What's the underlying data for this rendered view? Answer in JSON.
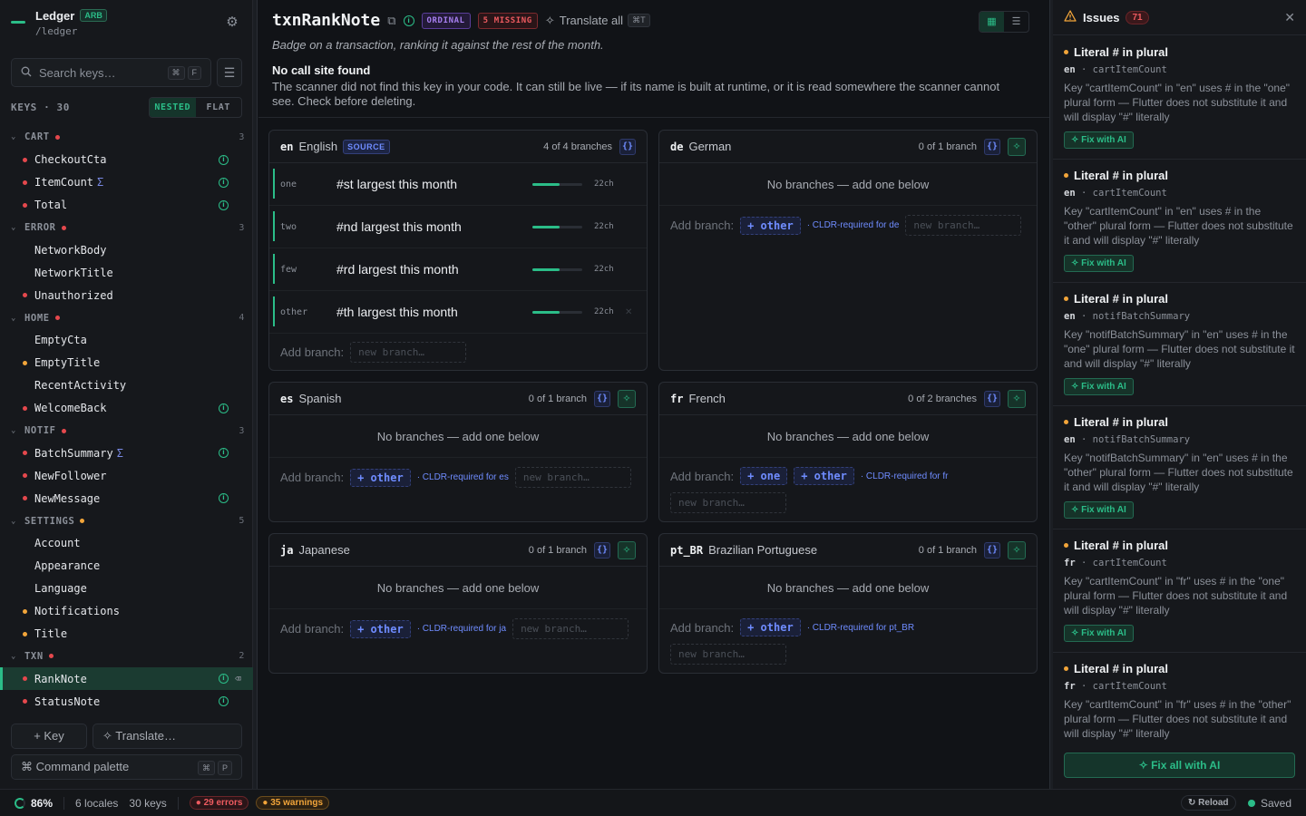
{
  "app": {
    "name": "Ledger",
    "format_badge": "ARB",
    "path": "/ledger"
  },
  "search": {
    "placeholder": "Search keys…",
    "kbd1": "⌘",
    "kbd2": "F"
  },
  "keys_header": "KEYS · 30",
  "view_mode": {
    "nested": "NESTED",
    "flat": "FLAT"
  },
  "tree": {
    "groups": [
      {
        "name": "CART",
        "count": "3",
        "dot": "red",
        "items": [
          {
            "label": "CheckoutCta",
            "bullet": "red",
            "info": true
          },
          {
            "label": "ItemCount",
            "bullet": "red",
            "info": true,
            "plural": true
          },
          {
            "label": "Total",
            "bullet": "red",
            "info": true
          }
        ]
      },
      {
        "name": "ERROR",
        "count": "3",
        "dot": "red",
        "items": [
          {
            "label": "NetworkBody"
          },
          {
            "label": "NetworkTitle"
          },
          {
            "label": "Unauthorized",
            "bullet": "red"
          }
        ]
      },
      {
        "name": "HOME",
        "count": "4",
        "dot": "red",
        "items": [
          {
            "label": "EmptyCta"
          },
          {
            "label": "EmptyTitle",
            "bullet": "orange"
          },
          {
            "label": "RecentActivity"
          },
          {
            "label": "WelcomeBack",
            "bullet": "red",
            "info": true
          }
        ]
      },
      {
        "name": "NOTIF",
        "count": "3",
        "dot": "red",
        "items": [
          {
            "label": "BatchSummary",
            "bullet": "red",
            "info": true,
            "plural": true
          },
          {
            "label": "NewFollower",
            "bullet": "red"
          },
          {
            "label": "NewMessage",
            "bullet": "red",
            "info": true
          }
        ]
      },
      {
        "name": "SETTINGS",
        "count": "5",
        "dot": "orange",
        "items": [
          {
            "label": "Account"
          },
          {
            "label": "Appearance"
          },
          {
            "label": "Language"
          },
          {
            "label": "Notifications",
            "bullet": "orange"
          },
          {
            "label": "Title",
            "bullet": "orange"
          }
        ]
      },
      {
        "name": "TXN",
        "count": "2",
        "dot": "red",
        "items": [
          {
            "label": "RankNote",
            "bullet": "red",
            "info": true,
            "selected": true
          },
          {
            "label": "StatusNote",
            "bullet": "red",
            "info": true
          }
        ]
      }
    ]
  },
  "sidebar_actions": {
    "add_key": "+ Key",
    "translate": "Translate…",
    "command_palette": "Command palette",
    "cmd_kbd1": "⌘",
    "cmd_kbd2": "P"
  },
  "key": {
    "title": "txnRankNote",
    "badge_type": "ORDINAL",
    "badge_missing": "5 MISSING",
    "translate_all": "Translate all",
    "translate_kbd": "⌘T",
    "description": "Badge on a transaction, ranking it against the rest of the month.",
    "warning_title": "No call site found",
    "warning_body": "The scanner did not find this key in your code. It can still be live — if its name is built at runtime, or it is read somewhere the scanner cannot see. Check before deleting."
  },
  "locales": {
    "en": {
      "code": "en",
      "name": "English",
      "source_badge": "SOURCE",
      "count": "4 of 4 branches",
      "branches": [
        {
          "form": "one",
          "text": "#st largest this month",
          "len": "22ch",
          "fill": 0.55
        },
        {
          "form": "two",
          "text": "#nd largest this month",
          "len": "22ch",
          "fill": 0.55
        },
        {
          "form": "few",
          "text": "#rd largest this month",
          "len": "22ch",
          "fill": 0.55
        },
        {
          "form": "other",
          "text": "#th largest this month",
          "len": "22ch",
          "fill": 0.55
        }
      ],
      "add_label": "Add branch:",
      "new_branch": "new branch…"
    },
    "de": {
      "code": "de",
      "name": "German",
      "count": "0 of 1 branch",
      "empty": "No branches — add one below",
      "add_label": "Add branch:",
      "chips": [
        "+ other"
      ],
      "cldr": "· CLDR-required for de",
      "new_branch": "new branch…"
    },
    "es": {
      "code": "es",
      "name": "Spanish",
      "count": "0 of 1 branch",
      "empty": "No branches — add one below",
      "add_label": "Add branch:",
      "chips": [
        "+ other"
      ],
      "cldr": "· CLDR-required for es",
      "new_branch": "new branch…"
    },
    "fr": {
      "code": "fr",
      "name": "French",
      "count": "0 of 2 branches",
      "empty": "No branches — add one below",
      "add_label": "Add branch:",
      "chips": [
        "+ one",
        "+ other"
      ],
      "cldr": "· CLDR-required for fr",
      "new_branch": "new branch…"
    },
    "ja": {
      "code": "ja",
      "name": "Japanese",
      "count": "0 of 1 branch",
      "empty": "No branches — add one below",
      "add_label": "Add branch:",
      "chips": [
        "+ other"
      ],
      "cldr": "· CLDR-required for ja",
      "new_branch": "new branch…"
    },
    "pt_BR": {
      "code": "pt_BR",
      "name": "Brazilian Portuguese",
      "count": "0 of 1 branch",
      "empty": "No branches — add one below",
      "add_label": "Add branch:",
      "chips": [
        "+ other"
      ],
      "cldr": "· CLDR-required for pt_BR",
      "new_branch": "new branch…"
    }
  },
  "issues_panel": {
    "title": "Issues",
    "count": "71",
    "fix_all": "Fix all with AI",
    "items": [
      {
        "title": "Literal # in plural",
        "locale": "en",
        "key": "cartItemCount",
        "body": "Key \"cartItemCount\" in \"en\" uses # in the \"one\" plural form — Flutter does not substitute it and will display \"#\" literally",
        "fix": "Fix with AI"
      },
      {
        "title": "Literal # in plural",
        "locale": "en",
        "key": "cartItemCount",
        "body": "Key \"cartItemCount\" in \"en\" uses # in the \"other\" plural form — Flutter does not substitute it and will display \"#\" literally",
        "fix": "Fix with AI"
      },
      {
        "title": "Literal # in plural",
        "locale": "en",
        "key": "notifBatchSummary",
        "body": "Key \"notifBatchSummary\" in \"en\" uses # in the \"one\" plural form — Flutter does not substitute it and will display \"#\" literally",
        "fix": "Fix with AI"
      },
      {
        "title": "Literal # in plural",
        "locale": "en",
        "key": "notifBatchSummary",
        "body": "Key \"notifBatchSummary\" in \"en\" uses # in the \"other\" plural form — Flutter does not substitute it and will display \"#\" literally",
        "fix": "Fix with AI"
      },
      {
        "title": "Literal # in plural",
        "locale": "fr",
        "key": "cartItemCount",
        "body": "Key \"cartItemCount\" in \"fr\" uses # in the \"one\" plural form — Flutter does not substitute it and will display \"#\" literally",
        "fix": "Fix with AI"
      },
      {
        "title": "Literal # in plural",
        "locale": "fr",
        "key": "cartItemCount",
        "body": "Key \"cartItemCount\" in \"fr\" uses # in the \"other\" plural form — Flutter does not substitute it and will display \"#\" literally",
        "fix": "Fix with AI"
      }
    ]
  },
  "status_bar": {
    "coverage": "86%",
    "coverage_fraction": 0.86,
    "locales": "6 locales",
    "keys": "30 keys",
    "errors": "● 29 errors",
    "warnings": "● 35 warnings",
    "reload": "Reload",
    "saved": "Saved"
  },
  "colors": {
    "accent": "#2bbd88",
    "error": "#e5484d",
    "warning": "#f2a53a",
    "info": "#6f8cff",
    "ordinal": "#a77ff0"
  }
}
